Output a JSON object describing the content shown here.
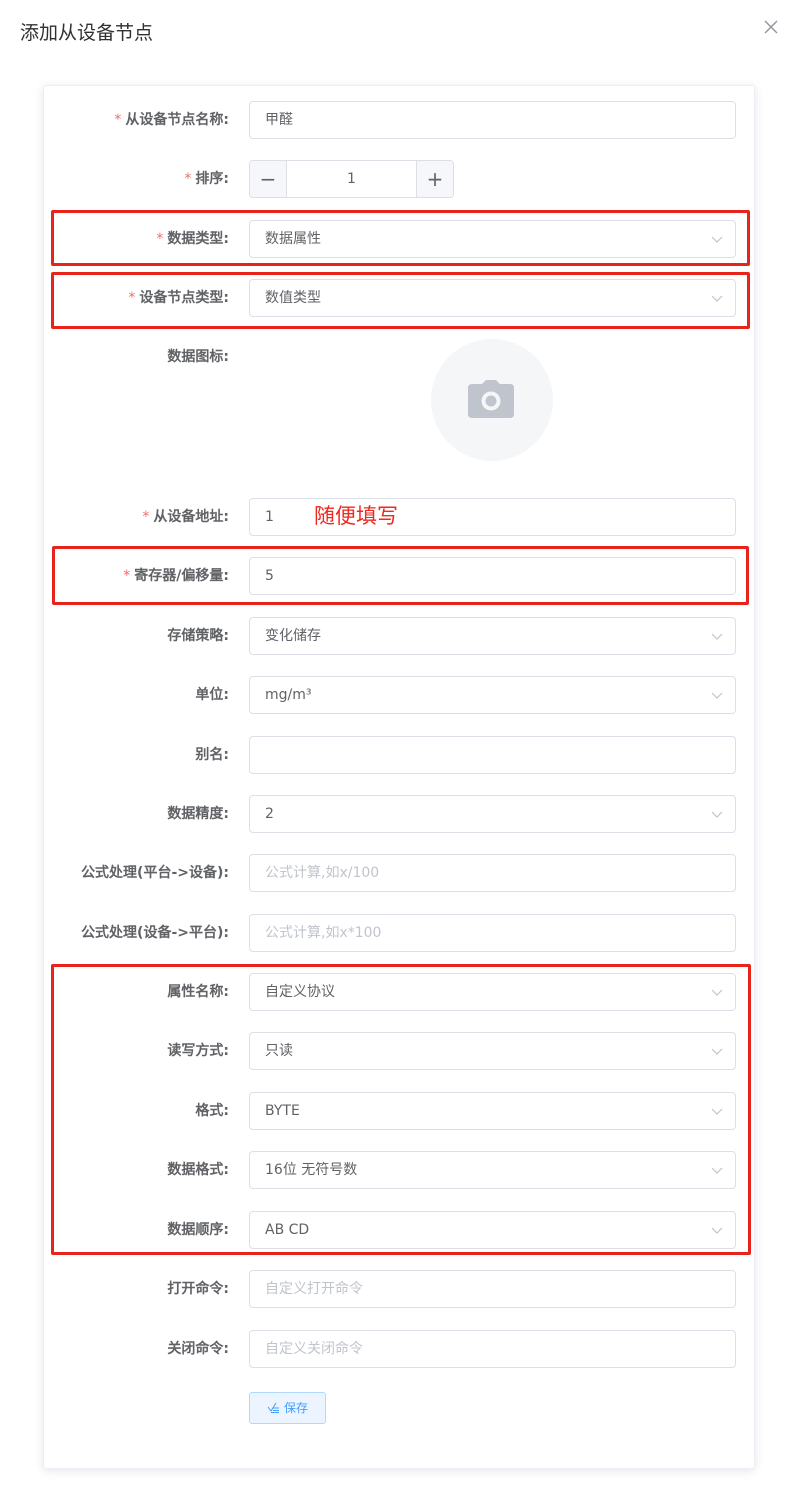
{
  "dialog": {
    "title": "添加从设备节点"
  },
  "form": {
    "node_name": {
      "label": "从设备节点名称:",
      "value": "甲醛",
      "required": true
    },
    "sort": {
      "label": "排序:",
      "value": "1",
      "required": true
    },
    "data_type": {
      "label": "数据类型:",
      "value": "数据属性",
      "required": true
    },
    "node_type": {
      "label": "设备节点类型:",
      "value": "数值类型",
      "required": true
    },
    "data_icon": {
      "label": "数据图标:"
    },
    "slave_address": {
      "label": "从设备地址:",
      "value": "1",
      "required": true,
      "note": "随便填写"
    },
    "register_offset": {
      "label": "寄存器/偏移量:",
      "value": "5",
      "required": true
    },
    "storage_strategy": {
      "label": "存储策略:",
      "value": "变化储存"
    },
    "unit": {
      "label": "单位:",
      "value": "mg/m³"
    },
    "alias": {
      "label": "别名:",
      "value": ""
    },
    "precision": {
      "label": "数据精度:",
      "value": "2"
    },
    "formula_to_device": {
      "label": "公式处理(平台->设备):",
      "placeholder": "公式计算,如x/100"
    },
    "formula_to_platform": {
      "label": "公式处理(设备->平台):",
      "placeholder": "公式计算,如x*100"
    },
    "attribute_name": {
      "label": "属性名称:",
      "value": "自定义协议"
    },
    "rw_mode": {
      "label": "读写方式:",
      "value": "只读"
    },
    "format": {
      "label": "格式:",
      "value": "BYTE"
    },
    "data_format": {
      "label": "数据格式:",
      "value": "16位 无符号数"
    },
    "data_order": {
      "label": "数据顺序:",
      "value": "AB CD"
    },
    "open_command": {
      "label": "打开命令:",
      "placeholder": "自定义打开命令"
    },
    "close_command": {
      "label": "关闭命令:",
      "placeholder": "自定义关闭命令"
    }
  },
  "buttons": {
    "save_label": "保存"
  },
  "colors": {
    "required": "#f56c6c",
    "highlight": "#e8231c",
    "primary": "#409eff"
  },
  "icons": [
    "close-icon",
    "camera-icon",
    "chevron-down-icon",
    "check-edit-icon",
    "minus-icon",
    "plus-icon"
  ]
}
